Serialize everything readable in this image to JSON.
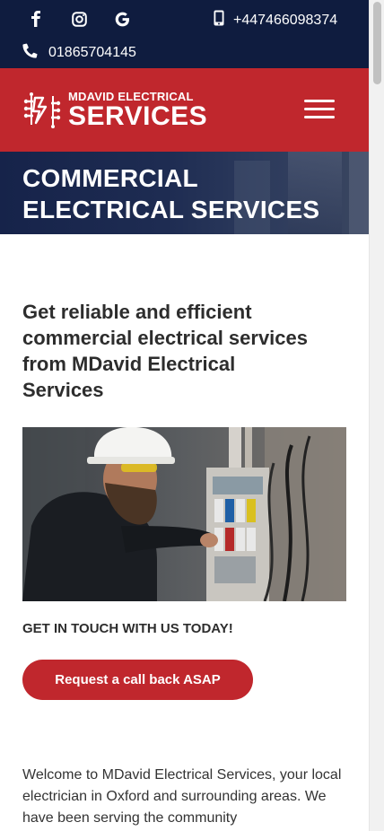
{
  "topbar": {
    "social": [
      {
        "name": "facebook-icon",
        "glyph": "f"
      },
      {
        "name": "instagram-icon",
        "glyph": "instagram"
      },
      {
        "name": "google-icon",
        "glyph": "G"
      }
    ],
    "mobile_phone": "+447466098374",
    "landline_phone": "01865704145"
  },
  "header": {
    "logo_small": "MDAVID ELECTRICAL",
    "logo_big": "SERVICES"
  },
  "hero": {
    "title_line1": "COMMERCIAL",
    "title_line2": "ELECTRICAL SERVICES"
  },
  "main": {
    "lead": "Get reliable and efficient commercial electrical services from MDavid Electrical Services",
    "cta_label": "GET IN TOUCH WITH US TODAY!",
    "cta_button": "Request a call back ASAP",
    "intro": "Welcome to MDavid Electrical Services, your local electrician in Oxford and surrounding areas. We have been serving the community"
  },
  "colors": {
    "topbar": "#0f1c3f",
    "brand_red": "#c0272d",
    "hero": "#1e2c52",
    "text": "#2d2d2d"
  }
}
